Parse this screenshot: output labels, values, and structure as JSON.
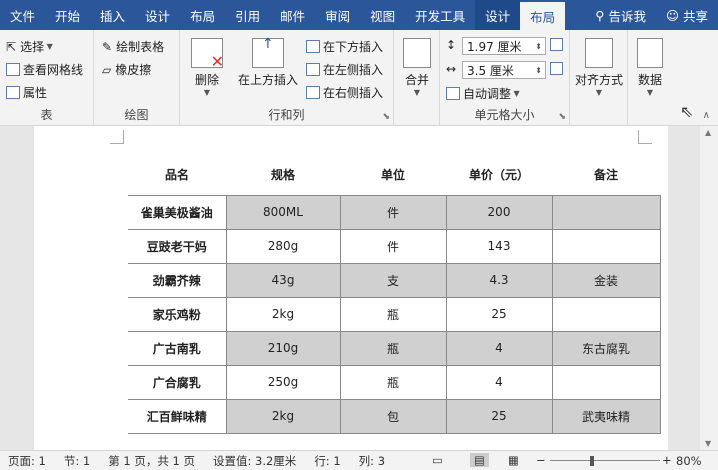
{
  "tabs": [
    {
      "label": "文件"
    },
    {
      "label": "开始"
    },
    {
      "label": "插入"
    },
    {
      "label": "设计"
    },
    {
      "label": "布局"
    },
    {
      "label": "引用"
    },
    {
      "label": "邮件"
    },
    {
      "label": "审阅"
    },
    {
      "label": "视图"
    },
    {
      "label": "开发工具"
    },
    {
      "label": "设计"
    },
    {
      "label": "布局"
    }
  ],
  "tell_me": "告诉我",
  "share": "共享",
  "ribbon": {
    "table": {
      "select": "选择",
      "gridlines": "查看网格线",
      "properties": "属性",
      "label": "表"
    },
    "draw": {
      "draw_table": "绘制表格",
      "eraser": "橡皮擦",
      "label": "绘图"
    },
    "rows_cols": {
      "delete": "删除",
      "insert_above": "在上方插入",
      "insert_below": "在下方插入",
      "insert_left": "在左侧插入",
      "insert_right": "在右侧插入",
      "label": "行和列"
    },
    "merge": {
      "label": "合并"
    },
    "cell_size": {
      "height": "1.97 厘米",
      "width": "3.5 厘米",
      "autofit": "自动调整",
      "label": "单元格大小"
    },
    "align": {
      "label": "对齐方式"
    },
    "data": {
      "label": "数据"
    }
  },
  "table": {
    "headers": [
      "品名",
      "规格",
      "单位",
      "单价（元）",
      "备注"
    ],
    "rows": [
      {
        "name": "雀巢美极酱油",
        "spec": "800ML",
        "unit": "件",
        "price": "200",
        "note": ""
      },
      {
        "name": "豆豉老干妈",
        "spec": "280g",
        "unit": "件",
        "price": "143",
        "note": ""
      },
      {
        "name": "劲霸芥辣",
        "spec": "43g",
        "unit": "支",
        "price": "4.3",
        "note": "金装"
      },
      {
        "name": "家乐鸡粉",
        "spec": "2kg",
        "unit": "瓶",
        "price": "25",
        "note": ""
      },
      {
        "name": "广古南乳",
        "spec": "210g",
        "unit": "瓶",
        "price": "4",
        "note": "东古腐乳"
      },
      {
        "name": "广合腐乳",
        "spec": "250g",
        "unit": "瓶",
        "price": "4",
        "note": ""
      },
      {
        "name": "汇百鲜味精",
        "spec": "2kg",
        "unit": "包",
        "price": "25",
        "note": "武夷味精"
      }
    ]
  },
  "status": {
    "page": "页面: 1",
    "section": "节: 1",
    "pages": "第 1 页，共 1 页",
    "setting": "设置值: 3.2厘米",
    "row": "行: 1",
    "col": "列: 3",
    "zoom": "80%"
  }
}
